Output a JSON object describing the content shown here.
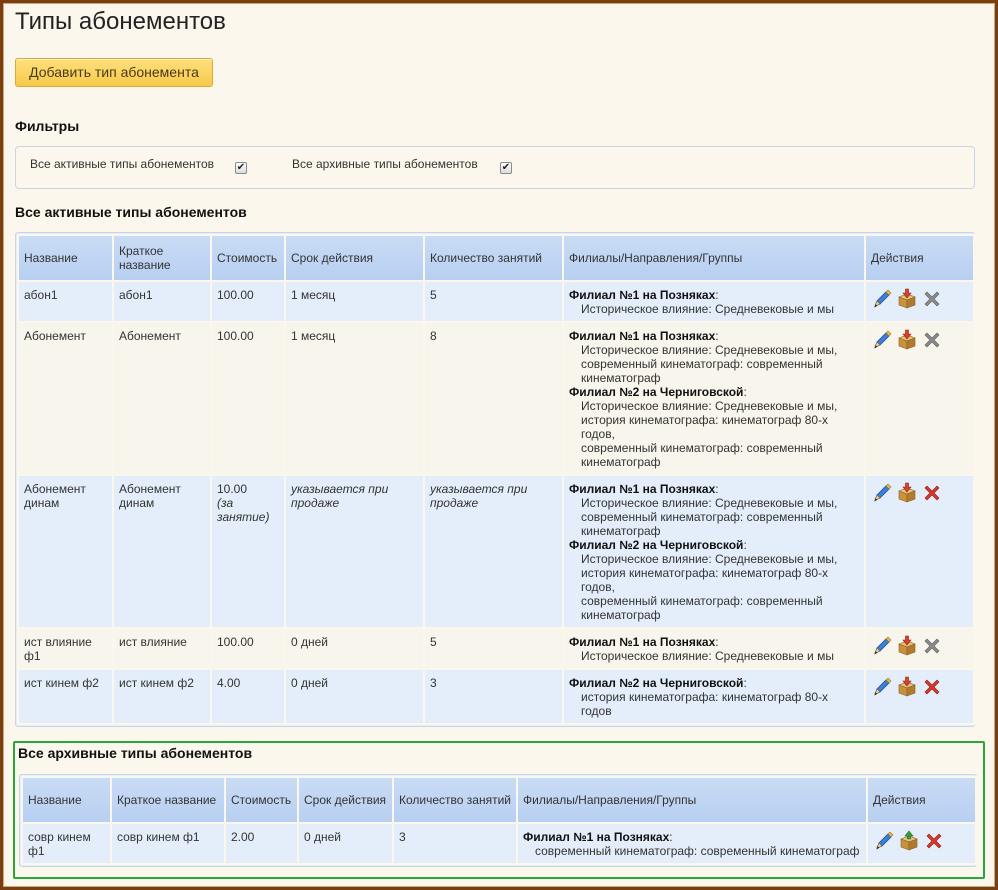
{
  "page": {
    "title": "Типы абонементов",
    "add_button": "Добавить тип абонемента"
  },
  "filters": {
    "title": "Фильтры",
    "items": [
      {
        "label": "Все активные типы абонементов",
        "checked": true
      },
      {
        "label": "Все архивные типы абонементов",
        "checked": true
      }
    ]
  },
  "active": {
    "title": "Все активные типы абонементов",
    "columns": [
      "Название",
      "Краткое название",
      "Стоимость",
      "Срок действия",
      "Количество занятий",
      "Филиалы/Направления/Группы",
      "Действия"
    ],
    "rows": [
      {
        "name": "абон1",
        "short": "абон1",
        "price": "100.00",
        "price_note": "",
        "term": "1 месяц",
        "term_italic": false,
        "count": "5",
        "count_italic": false,
        "branches": [
          {
            "name": "Филиал №1 на Позняках",
            "groups": [
              "Историческое влияние: Средневековые и мы"
            ]
          }
        ],
        "delete_active": false
      },
      {
        "name": "Абонемент",
        "short": "Абонемент",
        "price": "100.00",
        "price_note": "",
        "term": "1 месяц",
        "term_italic": false,
        "count": "8",
        "count_italic": false,
        "branches": [
          {
            "name": "Филиал №1 на Позняках",
            "groups": [
              "Историческое влияние: Средневековые и мы,",
              "современный кинематограф: современный кинематограф"
            ]
          },
          {
            "name": "Филиал №2 на Черниговской",
            "groups": [
              "Историческое влияние: Средневековые и мы,",
              "история кинематографа: кинематограф 80-х годов,",
              "современный кинематограф: современный кинематограф"
            ]
          }
        ],
        "delete_active": false
      },
      {
        "name": "Абонемент динам",
        "short": "Абонемент динам",
        "price": "10.00",
        "price_note": "(за занятие)",
        "term": "указывается при продаже",
        "term_italic": true,
        "count": "указывается при продаже",
        "count_italic": true,
        "branches": [
          {
            "name": "Филиал №1 на Позняках",
            "groups": [
              "Историческое влияние: Средневековые и мы,",
              "современный кинематограф: современный кинематограф"
            ]
          },
          {
            "name": "Филиал №2 на Черниговской",
            "groups": [
              "Историческое влияние: Средневековые и мы,",
              "история кинематографа: кинематограф 80-х годов,",
              "современный кинематограф: современный кинематограф"
            ]
          }
        ],
        "delete_active": true
      },
      {
        "name": "ист влияние ф1",
        "short": "ист влияние",
        "price": "100.00",
        "price_note": "",
        "term": "0 дней",
        "term_italic": false,
        "count": "5",
        "count_italic": false,
        "branches": [
          {
            "name": "Филиал №1 на Позняках",
            "groups": [
              "Историческое влияние: Средневековые и мы"
            ]
          }
        ],
        "delete_active": false
      },
      {
        "name": "ист кинем ф2",
        "short": "ист кинем ф2",
        "price": "4.00",
        "price_note": "",
        "term": "0 дней",
        "term_italic": false,
        "count": "3",
        "count_italic": false,
        "branches": [
          {
            "name": "Филиал №2 на Черниговской",
            "groups": [
              "история кинематографа: кинематограф 80-х годов"
            ]
          }
        ],
        "delete_active": true
      }
    ]
  },
  "archive": {
    "title": "Все архивные типы абонементов",
    "columns": [
      "Название",
      "Краткое название",
      "Стоимость",
      "Срок действия",
      "Количество занятий",
      "Филиалы/Направления/Группы",
      "Действия"
    ],
    "rows": [
      {
        "name": "совр кинем ф1",
        "short": "совр кинем ф1",
        "price": "2.00",
        "price_note": "",
        "term": "0 дней",
        "term_italic": false,
        "count": "3",
        "count_italic": false,
        "branches": [
          {
            "name": "Филиал №1 на Позняках",
            "groups": [
              "современный кинематограф: современный кинематограф"
            ]
          }
        ],
        "delete_active": true
      }
    ]
  },
  "colors": {
    "header_bg": "#b7cff1",
    "row_alt": "#e4eefa",
    "row_plain": "#f8f5ec",
    "archive_border": "#2aa53a",
    "button_bg": "#f6c94a",
    "delete_active": "#d8382c",
    "delete_inactive": "#8a8a8a"
  },
  "icons": {
    "edit": "pencil-icon",
    "archive": "box-arrow-icon",
    "delete": "cross-icon"
  }
}
